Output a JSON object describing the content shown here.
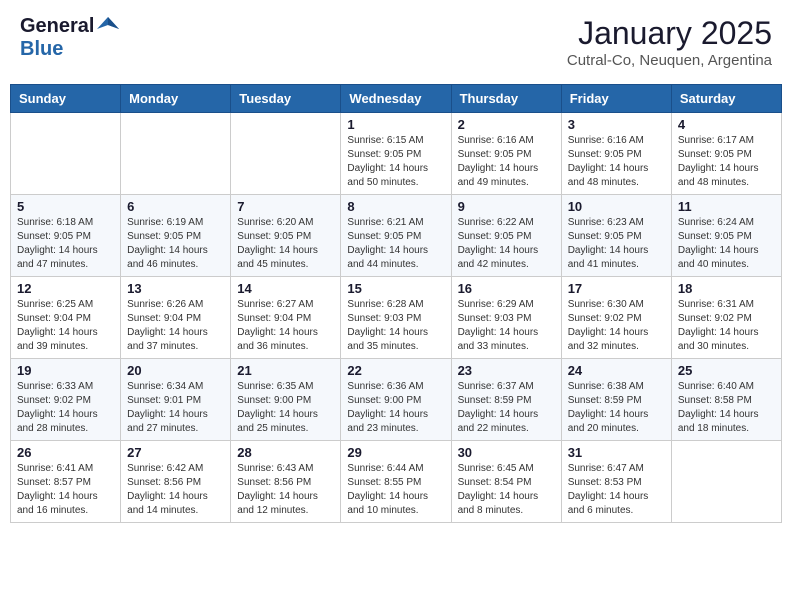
{
  "header": {
    "logo_general": "General",
    "logo_blue": "Blue",
    "month_title": "January 2025",
    "location": "Cutral-Co, Neuquen, Argentina"
  },
  "days_of_week": [
    "Sunday",
    "Monday",
    "Tuesday",
    "Wednesday",
    "Thursday",
    "Friday",
    "Saturday"
  ],
  "weeks": [
    [
      {
        "num": "",
        "info": ""
      },
      {
        "num": "",
        "info": ""
      },
      {
        "num": "",
        "info": ""
      },
      {
        "num": "1",
        "info": "Sunrise: 6:15 AM\nSunset: 9:05 PM\nDaylight: 14 hours\nand 50 minutes."
      },
      {
        "num": "2",
        "info": "Sunrise: 6:16 AM\nSunset: 9:05 PM\nDaylight: 14 hours\nand 49 minutes."
      },
      {
        "num": "3",
        "info": "Sunrise: 6:16 AM\nSunset: 9:05 PM\nDaylight: 14 hours\nand 48 minutes."
      },
      {
        "num": "4",
        "info": "Sunrise: 6:17 AM\nSunset: 9:05 PM\nDaylight: 14 hours\nand 48 minutes."
      }
    ],
    [
      {
        "num": "5",
        "info": "Sunrise: 6:18 AM\nSunset: 9:05 PM\nDaylight: 14 hours\nand 47 minutes."
      },
      {
        "num": "6",
        "info": "Sunrise: 6:19 AM\nSunset: 9:05 PM\nDaylight: 14 hours\nand 46 minutes."
      },
      {
        "num": "7",
        "info": "Sunrise: 6:20 AM\nSunset: 9:05 PM\nDaylight: 14 hours\nand 45 minutes."
      },
      {
        "num": "8",
        "info": "Sunrise: 6:21 AM\nSunset: 9:05 PM\nDaylight: 14 hours\nand 44 minutes."
      },
      {
        "num": "9",
        "info": "Sunrise: 6:22 AM\nSunset: 9:05 PM\nDaylight: 14 hours\nand 42 minutes."
      },
      {
        "num": "10",
        "info": "Sunrise: 6:23 AM\nSunset: 9:05 PM\nDaylight: 14 hours\nand 41 minutes."
      },
      {
        "num": "11",
        "info": "Sunrise: 6:24 AM\nSunset: 9:05 PM\nDaylight: 14 hours\nand 40 minutes."
      }
    ],
    [
      {
        "num": "12",
        "info": "Sunrise: 6:25 AM\nSunset: 9:04 PM\nDaylight: 14 hours\nand 39 minutes."
      },
      {
        "num": "13",
        "info": "Sunrise: 6:26 AM\nSunset: 9:04 PM\nDaylight: 14 hours\nand 37 minutes."
      },
      {
        "num": "14",
        "info": "Sunrise: 6:27 AM\nSunset: 9:04 PM\nDaylight: 14 hours\nand 36 minutes."
      },
      {
        "num": "15",
        "info": "Sunrise: 6:28 AM\nSunset: 9:03 PM\nDaylight: 14 hours\nand 35 minutes."
      },
      {
        "num": "16",
        "info": "Sunrise: 6:29 AM\nSunset: 9:03 PM\nDaylight: 14 hours\nand 33 minutes."
      },
      {
        "num": "17",
        "info": "Sunrise: 6:30 AM\nSunset: 9:02 PM\nDaylight: 14 hours\nand 32 minutes."
      },
      {
        "num": "18",
        "info": "Sunrise: 6:31 AM\nSunset: 9:02 PM\nDaylight: 14 hours\nand 30 minutes."
      }
    ],
    [
      {
        "num": "19",
        "info": "Sunrise: 6:33 AM\nSunset: 9:02 PM\nDaylight: 14 hours\nand 28 minutes."
      },
      {
        "num": "20",
        "info": "Sunrise: 6:34 AM\nSunset: 9:01 PM\nDaylight: 14 hours\nand 27 minutes."
      },
      {
        "num": "21",
        "info": "Sunrise: 6:35 AM\nSunset: 9:00 PM\nDaylight: 14 hours\nand 25 minutes."
      },
      {
        "num": "22",
        "info": "Sunrise: 6:36 AM\nSunset: 9:00 PM\nDaylight: 14 hours\nand 23 minutes."
      },
      {
        "num": "23",
        "info": "Sunrise: 6:37 AM\nSunset: 8:59 PM\nDaylight: 14 hours\nand 22 minutes."
      },
      {
        "num": "24",
        "info": "Sunrise: 6:38 AM\nSunset: 8:59 PM\nDaylight: 14 hours\nand 20 minutes."
      },
      {
        "num": "25",
        "info": "Sunrise: 6:40 AM\nSunset: 8:58 PM\nDaylight: 14 hours\nand 18 minutes."
      }
    ],
    [
      {
        "num": "26",
        "info": "Sunrise: 6:41 AM\nSunset: 8:57 PM\nDaylight: 14 hours\nand 16 minutes."
      },
      {
        "num": "27",
        "info": "Sunrise: 6:42 AM\nSunset: 8:56 PM\nDaylight: 14 hours\nand 14 minutes."
      },
      {
        "num": "28",
        "info": "Sunrise: 6:43 AM\nSunset: 8:56 PM\nDaylight: 14 hours\nand 12 minutes."
      },
      {
        "num": "29",
        "info": "Sunrise: 6:44 AM\nSunset: 8:55 PM\nDaylight: 14 hours\nand 10 minutes."
      },
      {
        "num": "30",
        "info": "Sunrise: 6:45 AM\nSunset: 8:54 PM\nDaylight: 14 hours\nand 8 minutes."
      },
      {
        "num": "31",
        "info": "Sunrise: 6:47 AM\nSunset: 8:53 PM\nDaylight: 14 hours\nand 6 minutes."
      },
      {
        "num": "",
        "info": ""
      }
    ]
  ]
}
